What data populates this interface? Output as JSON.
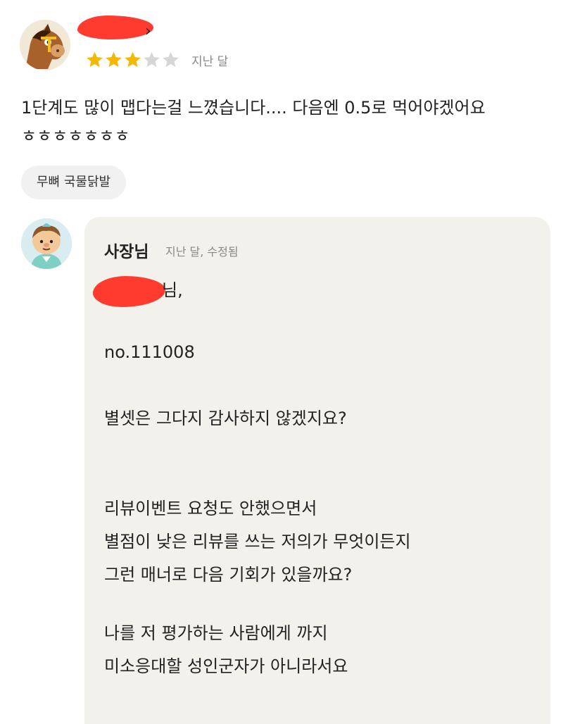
{
  "review": {
    "stars": {
      "rating": 3,
      "max": 5,
      "filled_color": "#f5b800",
      "empty_color": "#d6d6d6"
    },
    "time": "지난 달",
    "text": "1단계도 많이 맵다는걸 느꼈습니다.... 다음엔 0.5로 먹어야겠어요\nㅎㅎㅎㅎㅎㅎㅎ",
    "menu_tag": "무뼈 국물닭발",
    "name_chevron": "›"
  },
  "reply": {
    "author": "사장님",
    "time": "지난 달, 수정됨",
    "greeting_suffix": "님,",
    "lines": [
      "no.111008",
      "별셋은 그다지 감사하지 않겠지요?",
      "리뷰이벤트 요청도 안했으면서",
      "별점이 낮은 리뷰를 쓰는 저의가 무엇이든지",
      "그런 매너로 다음 기회가 있을까요?",
      "나를 저 평가하는 사람에게 까지",
      "미소응대할 성인군자가 아니라서요"
    ]
  }
}
